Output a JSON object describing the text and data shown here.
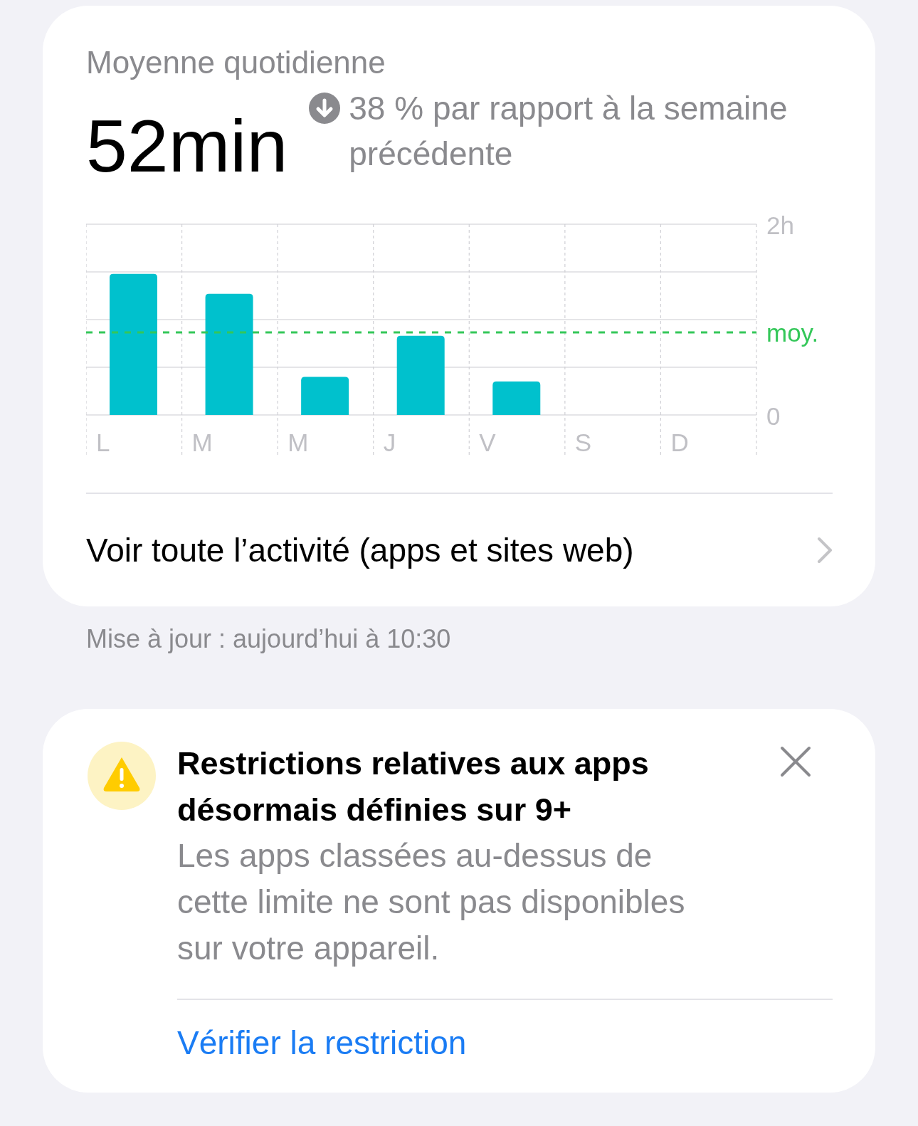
{
  "summary": {
    "title": "Moyenne quotidienne",
    "value": "52min",
    "trend": {
      "text": "38 % par rapport à la semaine précédente"
    }
  },
  "chart": {
    "chart_data": {
      "type": "bar",
      "categories": [
        "L",
        "M",
        "M",
        "J",
        "V",
        "S",
        "D"
      ],
      "series": [
        {
          "color": "#00c1cd",
          "values": [
            1.48,
            1.27,
            0.4,
            0.83,
            0.35,
            0,
            0
          ]
        }
      ],
      "ylim": [
        0,
        2
      ],
      "yticks": [
        {
          "value": 0,
          "label": "0"
        },
        {
          "value": 2,
          "label": "2h"
        }
      ]
    },
    "average_label": "moy."
  },
  "activity_link": {
    "label": "Voir toute l’activité (apps et sites web)"
  },
  "updated": "Mise à jour : aujourd’hui à 10:30",
  "alert": {
    "title": "Restrictions relatives aux apps désormais définies sur 9+",
    "body": "Les apps classées au-dessus de cette limite ne sont pas disponibles sur votre appareil.",
    "action": "Vérifier la restriction"
  }
}
